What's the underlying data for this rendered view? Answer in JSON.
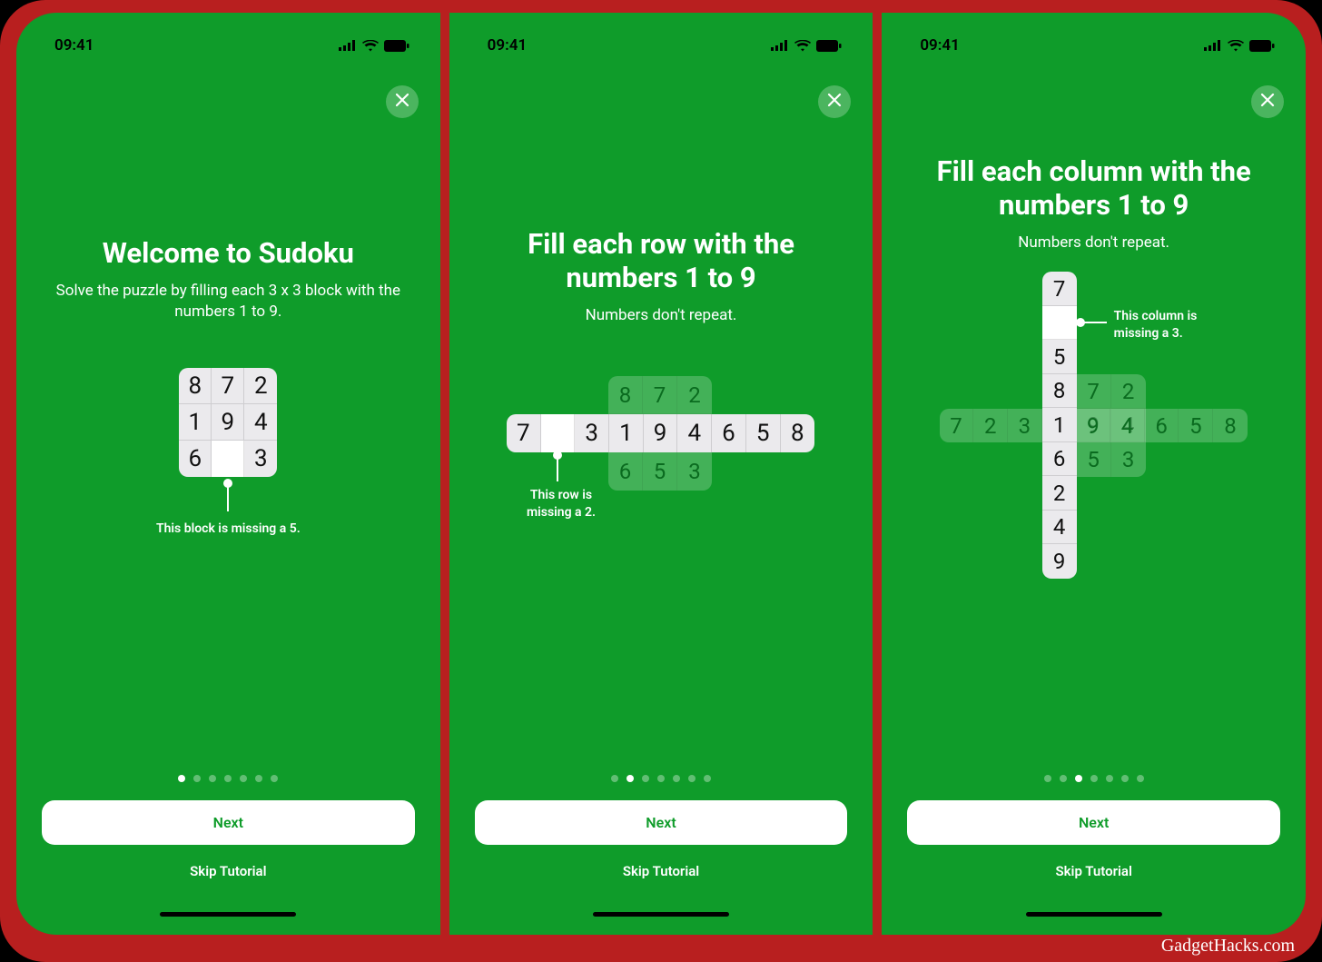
{
  "status": {
    "time": "09:41"
  },
  "watermark": "GadgetHacks.com",
  "buttons": {
    "next": "Next",
    "skip": "Skip Tutorial"
  },
  "page_dots_total": 7,
  "panels": [
    {
      "title": "Welcome to Sudoku",
      "subtitle": "Solve the puzzle by filling each 3 x 3 block with the numbers 1 to 9.",
      "hint": "This block is missing a 5.",
      "active_dot": 0,
      "block": [
        "8",
        "7",
        "2",
        "1",
        "9",
        "4",
        "6",
        "",
        "3"
      ]
    },
    {
      "title": "Fill each row with the numbers 1 to 9",
      "subtitle": "Numbers don't repeat.",
      "hint": "This row is missing a 2.",
      "active_dot": 1,
      "ghost_block": [
        "8",
        "7",
        "2",
        "",
        "",
        "",
        "6",
        "5",
        "3"
      ],
      "row": [
        "7",
        "",
        "3",
        "1",
        "9",
        "4",
        "6",
        "5",
        "8"
      ]
    },
    {
      "title": "Fill each column with the numbers 1 to 9",
      "subtitle": "Numbers don't repeat.",
      "hint": "This column is missing a 3.",
      "active_dot": 2,
      "column": [
        "7",
        "",
        "5",
        "8",
        "1",
        "6",
        "2",
        "4",
        "9"
      ],
      "ghost_block_right": [
        "7",
        "2",
        "9",
        "4",
        "5",
        "3"
      ],
      "ghost_row": [
        "7",
        "2",
        "3",
        "1",
        "9",
        "4",
        "6",
        "5",
        "8"
      ]
    }
  ]
}
